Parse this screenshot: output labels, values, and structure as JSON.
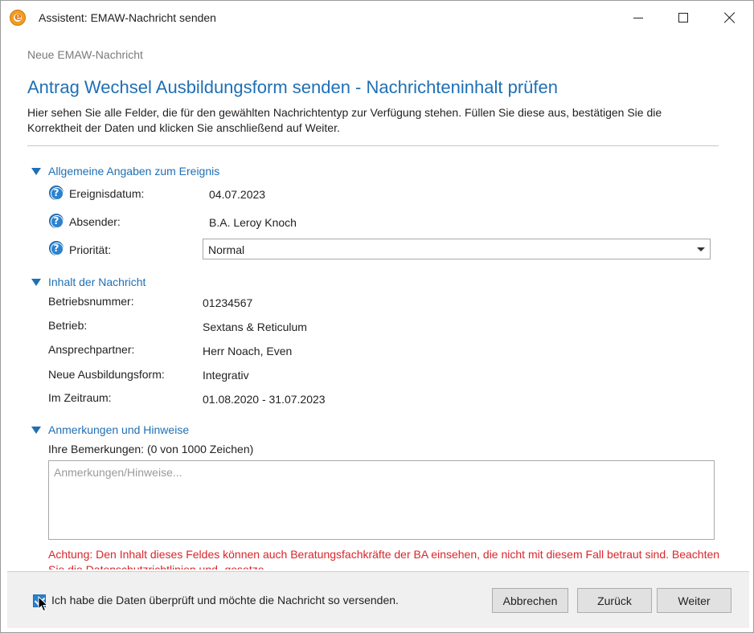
{
  "window": {
    "title": "Assistent: EMAW-Nachricht senden",
    "app_icon_letter": "e"
  },
  "subheader": "Neue EMAW-Nachricht",
  "heading": "Antrag Wechsel Ausbildungsform senden - Nachrichteninhalt prüfen",
  "description": "Hier sehen Sie alle Felder, die für den gewählten Nachrichtentyp zur Verfügung stehen. Füllen Sie diese aus, bestätigen Sie die Korrektheit der Daten und klicken Sie anschließend auf Weiter.",
  "sections": {
    "general": {
      "title": "Allgemeine Angaben zum Ereignis",
      "date_label": "Ereignisdatum:",
      "date_value": "04.07.2023",
      "sender_label": "Absender:",
      "sender_value": "B.A. Leroy Knoch",
      "priority_label": "Priorität:",
      "priority_value": "Normal"
    },
    "content": {
      "title": "Inhalt der Nachricht",
      "rows": [
        {
          "label": "Betriebsnummer:",
          "value": "01234567"
        },
        {
          "label": "Betrieb:",
          "value": "Sextans & Reticulum"
        },
        {
          "label": "Ansprechpartner:",
          "value": "Herr Noach, Even"
        },
        {
          "label": "Neue Ausbildungsform:",
          "value": "Integrativ"
        },
        {
          "label": "Im Zeitraum:",
          "value": "01.08.2020 - 31.07.2023"
        }
      ]
    },
    "notes": {
      "title": "Anmerkungen und Hinweise",
      "remarks_label": "Ihre Bemerkungen: (0 von 1000 Zeichen)",
      "placeholder": "Anmerkungen/Hinweise...",
      "value": "",
      "warning": "Achtung: Den Inhalt dieses Feldes können auch Beratungsfachkräfte der BA einsehen, die nicht mit diesem Fall betraut sind. Beachten Sie die Datenschutzrichtlinien und -gesetze."
    }
  },
  "footer": {
    "confirm_label": "Ich habe die Daten überprüft und möchte die Nachricht so versenden.",
    "confirm_checked": true,
    "cancel_label": "Abbrechen",
    "back_label": "Zurück",
    "next_label": "Weiter"
  },
  "colors": {
    "accent": "#1f6fb5",
    "warning": "#d9262b",
    "app_icon": "#f39c1f"
  }
}
